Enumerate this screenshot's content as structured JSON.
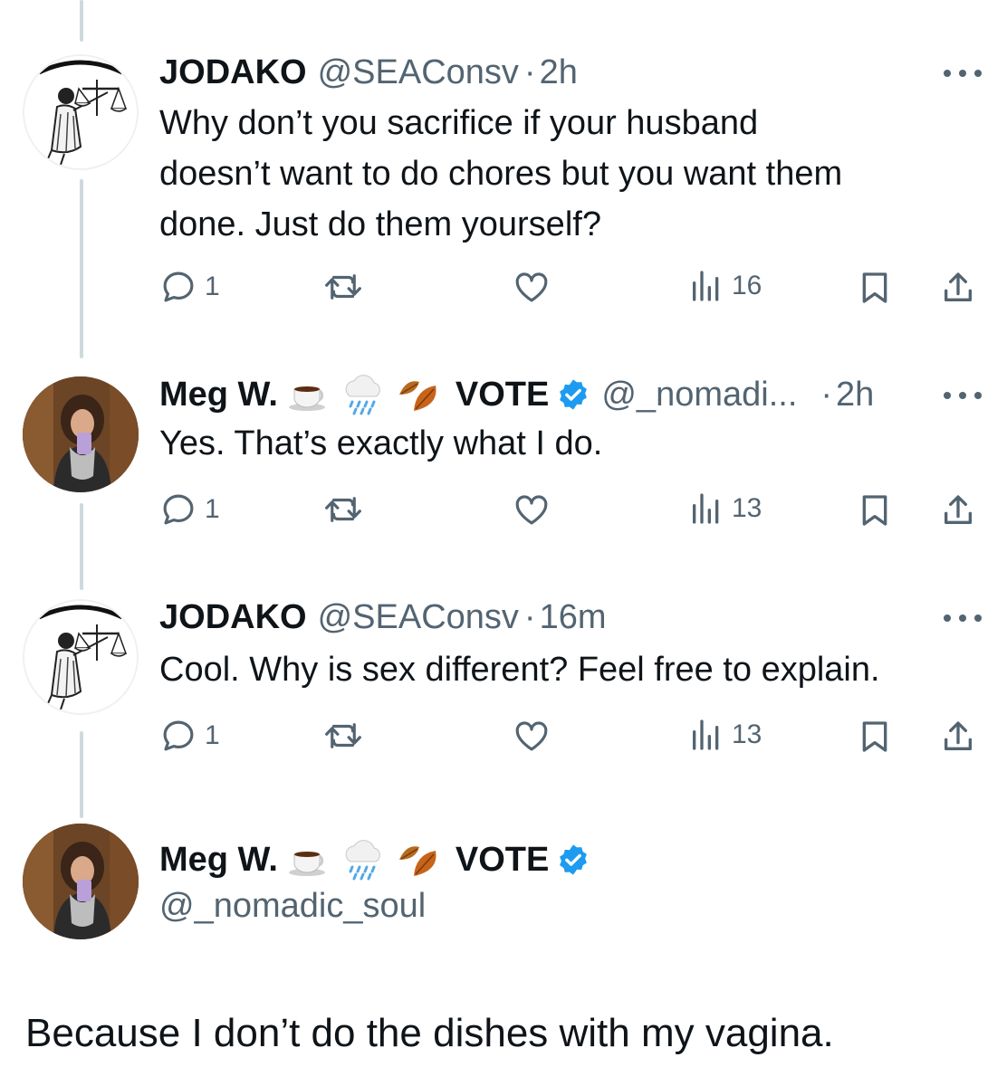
{
  "tweets": [
    {
      "name": "JODAKO",
      "handle": "@SEAConsv",
      "separator": "·",
      "time": "2h",
      "text_lines": [
        "Why don’t you sacrifice if your husband",
        "doesn’t want to do chores but you want them",
        "done. Just do them yourself?"
      ],
      "replies": "1",
      "views": "16",
      "avatar": "scales-of-justice-avatar"
    },
    {
      "name": "Meg W.",
      "emoji_names": [
        "coffee-emoji",
        "rain-cloud-emoji",
        "fallen-leaf-emoji"
      ],
      "name_suffix": "VOTE",
      "handle": "@_nomadi...",
      "separator": "·",
      "time": "2h",
      "text_lines": [
        "Yes. That’s exactly what I do."
      ],
      "replies": "1",
      "views": "13",
      "avatar": "selfie-photo-avatar"
    },
    {
      "name": "JODAKO",
      "handle": "@SEAConsv",
      "separator": "·",
      "time": "16m",
      "text_lines": [
        "Cool. Why is sex different? Feel free to explain."
      ],
      "replies": "1",
      "views": "13",
      "avatar": "scales-of-justice-avatar"
    }
  ],
  "focused_tweet": {
    "name": "Meg W.",
    "emoji_names": [
      "coffee-emoji",
      "rain-cloud-emoji",
      "fallen-leaf-emoji"
    ],
    "name_suffix": "VOTE",
    "handle": "@_nomadic_soul",
    "text": "Because I don’t do the dishes with my vagina.",
    "avatar": "selfie-photo-avatar"
  },
  "icons": {
    "reply": "reply-icon",
    "retweet": "retweet-icon",
    "like": "heart-icon",
    "views": "views-chart-icon",
    "bookmark": "bookmark-icon",
    "share": "share-icon",
    "more": "more-dots-icon",
    "verified": "verified-badge-icon"
  },
  "colors": {
    "text": "#0f1419",
    "secondary": "#536471",
    "verified_blue": "#1d9bf0",
    "thread_line": "#cfd9de"
  }
}
